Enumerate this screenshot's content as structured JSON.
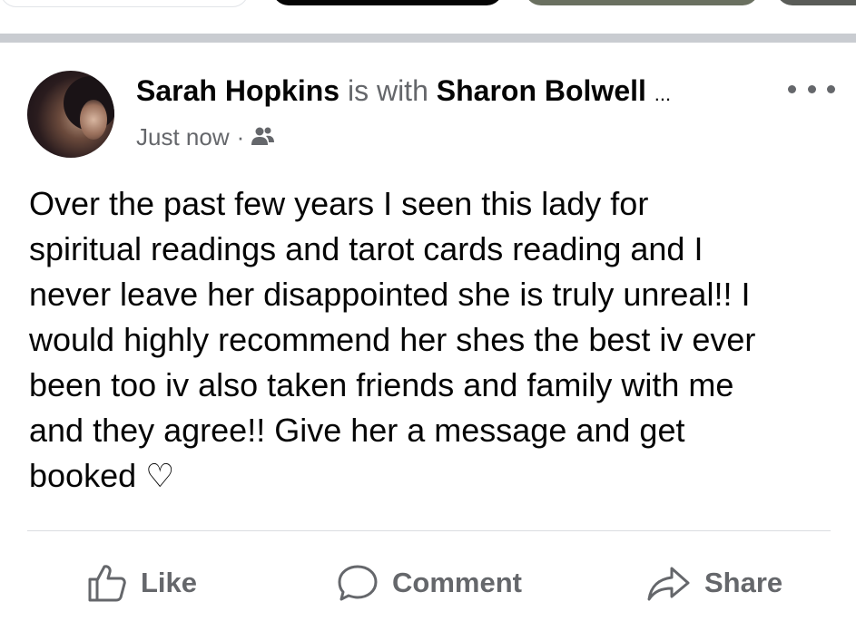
{
  "post": {
    "author": "Sarah Hopkins",
    "with_text": "is with",
    "tagged": "Sharon Bolwell",
    "tagged_more": "...",
    "timestamp": "Just now",
    "separator_dot": "·",
    "audience_icon": "friends-icon",
    "more_icon": "more-options-icon",
    "body": "Over the past few years I seen this lady for\nspiritual readings and tarot cards reading and I\nnever leave her disappointed she is truly unreal!! I\nwould highly recommend her shes the best iv ever\nbeen too iv also taken friends and family with me\nand they agree!! Give her a message and get\nbooked ♡"
  },
  "actions": {
    "like_label": "Like",
    "like_icon": "thumbs-up-icon",
    "comment_label": "Comment",
    "comment_icon": "comment-bubble-icon",
    "share_label": "Share",
    "share_icon": "share-arrow-icon"
  },
  "colors": {
    "primary_text": "#050505",
    "secondary_text": "#65676b",
    "separator": "#c9ccd1",
    "divider": "#dadde1"
  }
}
